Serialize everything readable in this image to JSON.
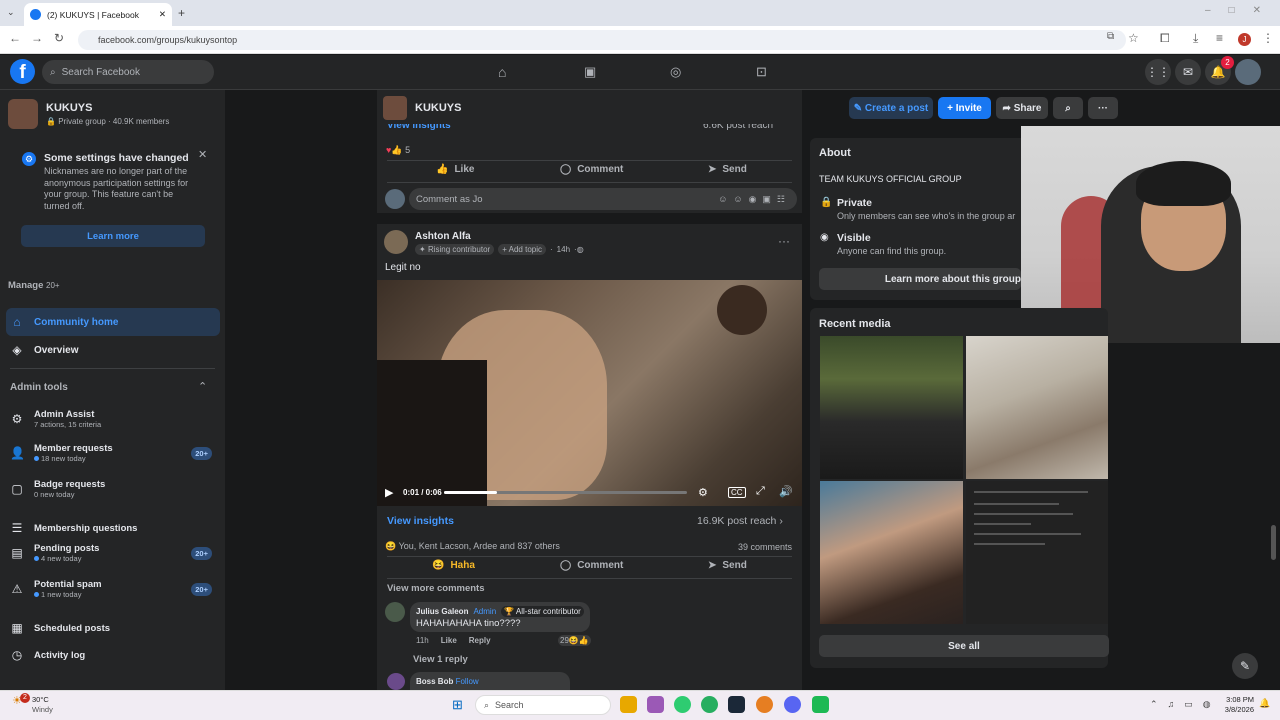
{
  "browser": {
    "tab_title": "(2) KUKUYS | Facebook",
    "url": "facebook.com/groups/kukuysontop"
  },
  "fb": {
    "search_placeholder": "Search Facebook",
    "notif_count": "2"
  },
  "group": {
    "name": "KUKUYS",
    "meta": "Private group · 40.9K members"
  },
  "notice": {
    "title": "Some settings have changed",
    "body": "Nicknames are no longer part of the anonymous participation settings for your group. This feature can't be turned off.",
    "button": "Learn more"
  },
  "sidebar": {
    "manage_label": "Manage",
    "manage_count": "20+",
    "community_home": "Community home",
    "overview": "Overview",
    "admin_tools": "Admin tools",
    "items": [
      {
        "title": "Admin Assist",
        "sub": "7 actions, 15 criteria",
        "badge": ""
      },
      {
        "title": "Member requests",
        "sub": "18 new today",
        "badge": "20+"
      },
      {
        "title": "Badge requests",
        "sub": "0 new today",
        "badge": ""
      },
      {
        "title": "Membership questions",
        "sub": "",
        "badge": ""
      },
      {
        "title": "Pending posts",
        "sub": "4 new today",
        "badge": "20+"
      },
      {
        "title": "Potential spam",
        "sub": "1 new today",
        "badge": "20+"
      },
      {
        "title": "Scheduled posts",
        "sub": "",
        "badge": ""
      },
      {
        "title": "Activity log",
        "sub": "",
        "badge": ""
      }
    ]
  },
  "topbar": {
    "group_name": "KUKUYS",
    "create_post": "Create a post",
    "invite": "Invite",
    "share": "Share"
  },
  "post_prev": {
    "view_insights": "View insights",
    "post_reach": "6.6K post reach",
    "reaction_count": "5",
    "like": "Like",
    "comment": "Comment",
    "send": "Send",
    "comment_placeholder": "Comment as Jo"
  },
  "post": {
    "author": "Ashton Alfa",
    "badge": "Rising contributor",
    "add_topic": "Add topic",
    "time": "14h",
    "text": "Legit no",
    "video_time": "0:01 / 0:06",
    "video_progress": 0.22,
    "view_insights": "View insights",
    "post_reach": "16.9K post reach",
    "reactions_text": "You, Kent Lacson, Ardee and 837 others",
    "comments_count": "39 comments",
    "haha": "Haha",
    "comment": "Comment",
    "send": "Send",
    "view_more": "View more comments"
  },
  "comment1": {
    "author": "Julius Galeon",
    "role": "Admin",
    "badge": "All-star contributor",
    "text": "HAHAHAHAHA tino????",
    "time": "11h",
    "like": "Like",
    "reply": "Reply",
    "reactions": "29",
    "view_reply": "View 1 reply"
  },
  "comment2": {
    "author": "Boss Bob",
    "follow": "Follow"
  },
  "about": {
    "title": "About",
    "desc": "TEAM KUKUYS OFFICIAL GROUP",
    "private_title": "Private",
    "private_desc": "Only members can see who's in the group ar",
    "visible_title": "Visible",
    "visible_desc": "Anyone can find this group.",
    "learn_more": "Learn more about this group"
  },
  "media": {
    "title": "Recent media",
    "see_all": "See all"
  },
  "taskbar": {
    "temp": "30°C",
    "weather": "Windy",
    "search": "Search",
    "time": "3:08 PM",
    "date": "3/8/2026",
    "badge": "2"
  },
  "colors": {
    "accent": "#1877f2",
    "bg": "#18191a",
    "card": "#242526"
  }
}
